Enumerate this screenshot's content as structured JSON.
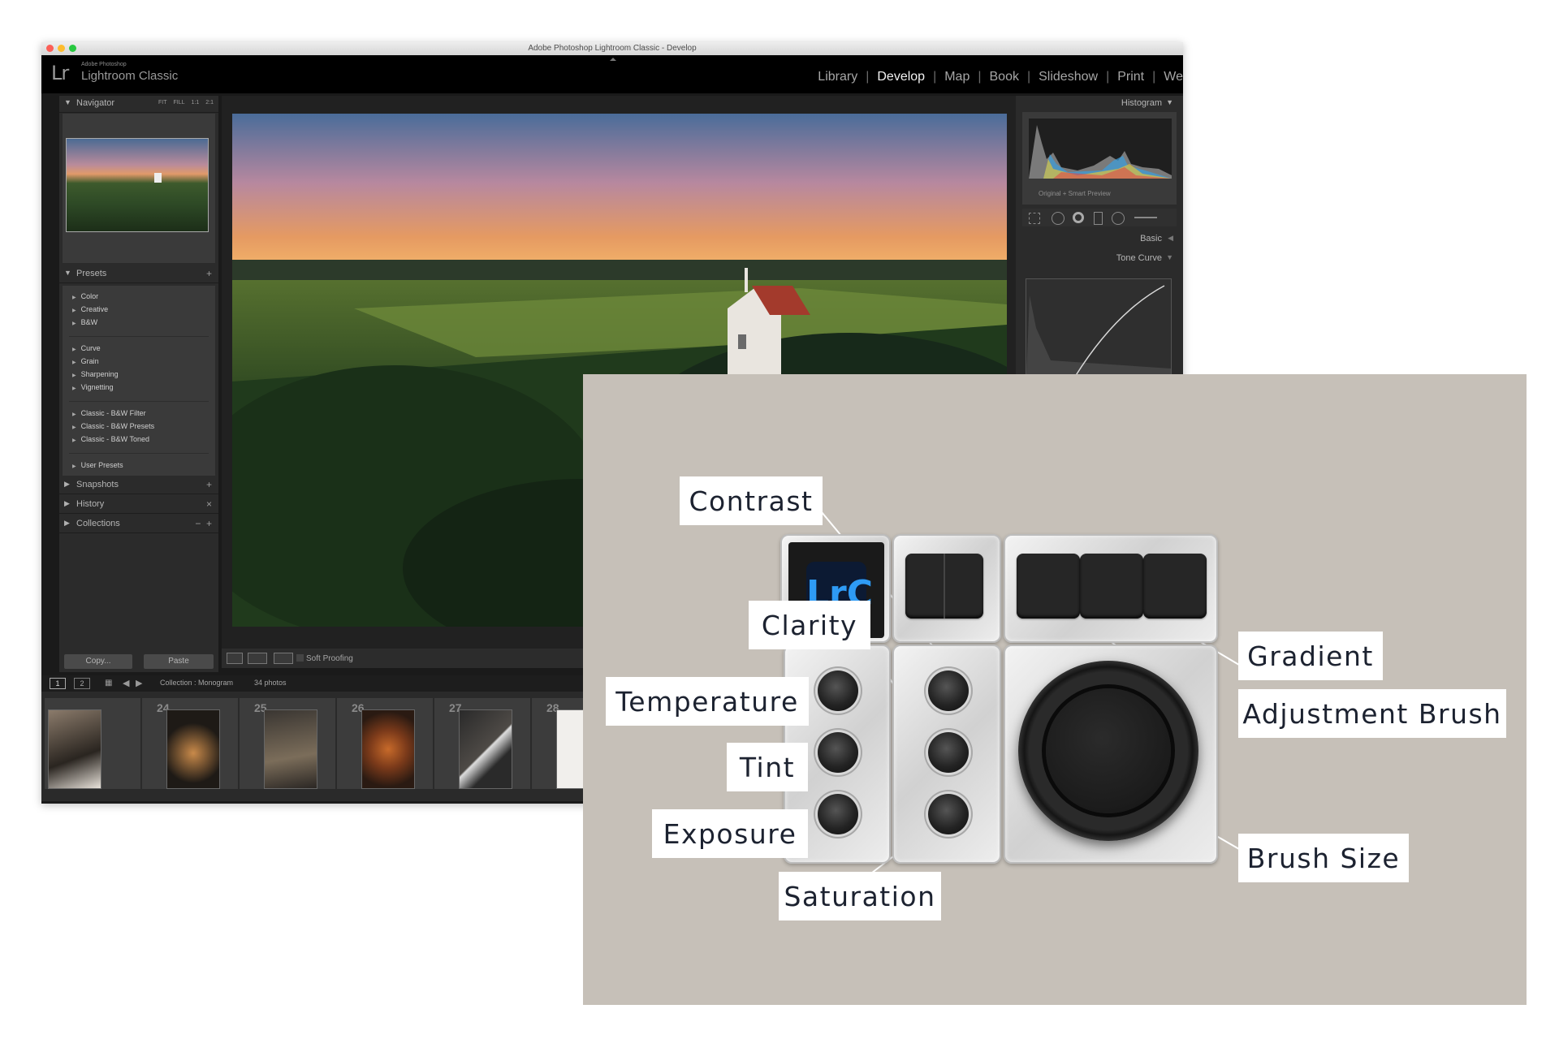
{
  "window": {
    "title": "Adobe Photoshop Lightroom Classic - Develop",
    "brand_small": "Adobe Photoshop",
    "brand_large": "Lightroom Classic",
    "logo": "Lr"
  },
  "modules": [
    "Library",
    "Develop",
    "Map",
    "Book",
    "Slideshow",
    "Print",
    "We"
  ],
  "active_module": "Develop",
  "left_panel": {
    "navigator": {
      "title": "Navigator",
      "zoom_options": [
        "FIT",
        "FILL",
        "1:1",
        "2:1"
      ]
    },
    "presets": {
      "title": "Presets",
      "groups": [
        [
          "Color",
          "Creative",
          "B&W"
        ],
        [
          "Curve",
          "Grain",
          "Sharpening",
          "Vignetting"
        ],
        [
          "Classic - B&W Filter",
          "Classic - B&W Presets",
          "Classic - B&W Toned"
        ],
        [
          "User Presets"
        ]
      ]
    },
    "snapshots": "Snapshots",
    "history": "History",
    "collections": "Collections",
    "copy": "Copy...",
    "paste": "Paste"
  },
  "toolbar": {
    "soft_proofing": "Soft Proofing"
  },
  "right_panel": {
    "histogram": "Histogram",
    "histogram_info": "Original + Smart Preview",
    "basic": "Basic",
    "tone_curve": "Tone Curve"
  },
  "filmstrip": {
    "pages": [
      "1",
      "2"
    ],
    "collection": "Collection : Monogram",
    "count": "34 photos",
    "frame_numbers": [
      "",
      "24",
      "25",
      "26",
      "27",
      "28"
    ]
  },
  "callouts": {
    "contrast": "Contrast",
    "clarity": "Clarity",
    "temperature": "Temperature",
    "tint": "Tint",
    "exposure": "Exposure",
    "saturation": "Saturation",
    "gradient": "Gradient",
    "adjustment_brush": "Adjustment Brush",
    "brush_size": "Brush Size"
  },
  "device": {
    "screen_label": "LrC"
  },
  "colors": {
    "overlay_bg": "#c6c0b8",
    "lr_bg": "#1a1a1a",
    "accent_blue": "#2e9bf5"
  }
}
